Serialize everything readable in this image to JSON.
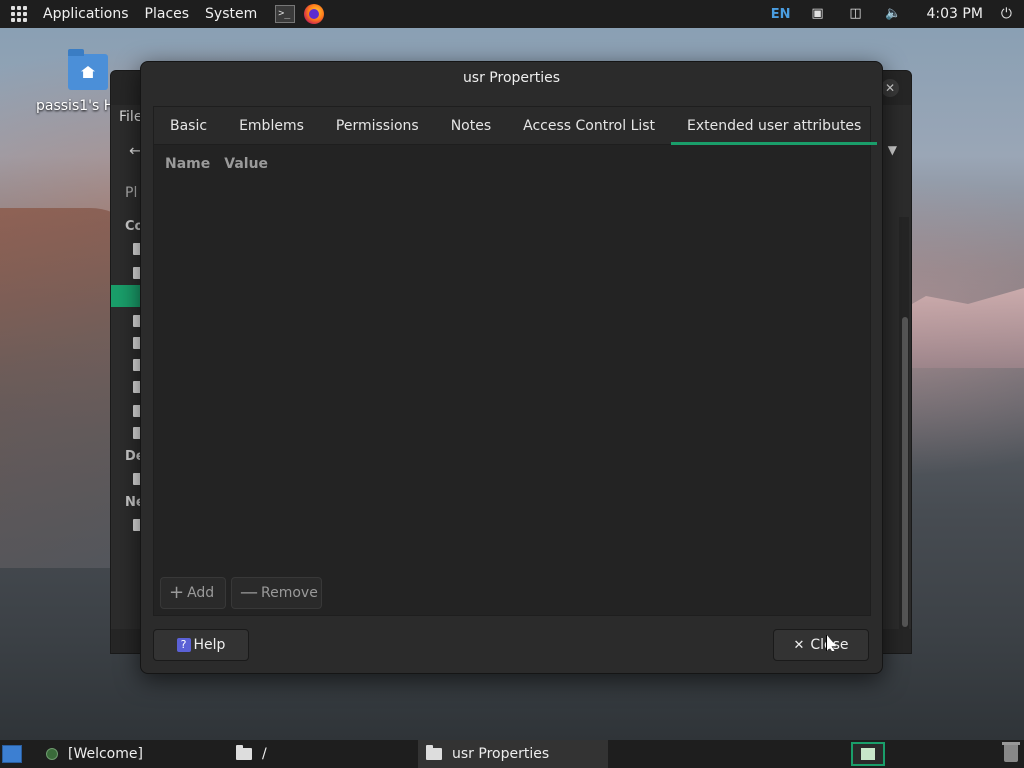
{
  "top_panel": {
    "menus": [
      "Applications",
      "Places",
      "System"
    ],
    "keyboard_layout": "EN",
    "clock": "4:03 PM"
  },
  "desktop": {
    "home_icon_label": "passis1's H"
  },
  "file_manager": {
    "menu_partial": "File",
    "places_partial": "Pl",
    "sidebar_headers": [
      "Co",
      "De",
      "Ne"
    ]
  },
  "dialog": {
    "title": "usr Properties",
    "tabs": [
      {
        "label": "Basic",
        "active": false
      },
      {
        "label": "Emblems",
        "active": false
      },
      {
        "label": "Permissions",
        "active": false
      },
      {
        "label": "Notes",
        "active": false
      },
      {
        "label": "Access Control List",
        "active": false
      },
      {
        "label": "Extended user attributes",
        "active": true
      }
    ],
    "columns": [
      "Name",
      "Value"
    ],
    "add_label": "Add",
    "remove_label": "Remove",
    "help_label": "Help",
    "close_label": "Close"
  },
  "taskbar": {
    "tasks": [
      "[Welcome]",
      "/",
      "usr Properties"
    ]
  },
  "colors": {
    "accent": "#1a9e6a",
    "panel": "#1e1e1e",
    "dialog_bg": "#2b2b2b"
  }
}
